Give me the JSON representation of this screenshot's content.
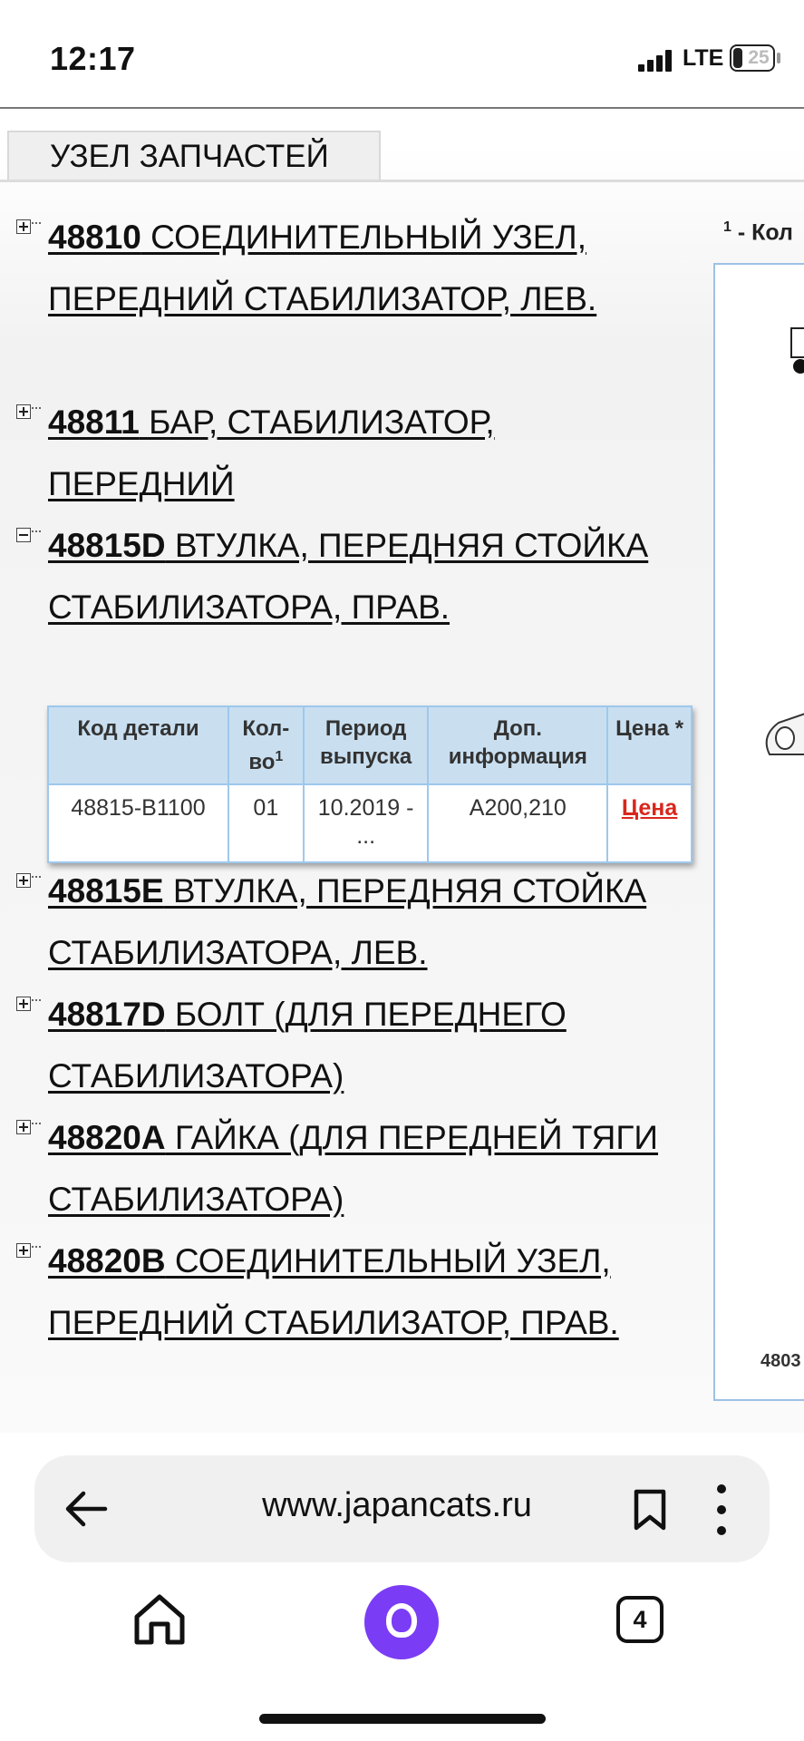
{
  "status": {
    "time": "12:17",
    "network": "LTE",
    "battery": "25"
  },
  "page": {
    "tab_title": "УЗЕЛ ЗАПЧАСТЕЙ",
    "caption_sup": "1",
    "caption_text": " - Кол",
    "diagram_code": "4803"
  },
  "parts": [
    {
      "code": "48810",
      "name": " СОЕДИНИТЕЛЬНЫЙ УЗЕЛ, ПЕРЕДНИЙ СТАБИЛИЗАТОР, ЛЕВ.",
      "expanded": false
    },
    {
      "code": "48811",
      "name": " БАР, СТАБИЛИЗАТОР, ПЕРЕДНИЙ",
      "expanded": false
    },
    {
      "code": "48815D",
      "name": " ВТУЛКА, ПЕРЕДНЯЯ СТОЙКА СТАБИЛИЗАТОРА, ПРАВ.",
      "expanded": true
    },
    {
      "code": "48815E",
      "name": " ВТУЛКА, ПЕРЕДНЯЯ СТОЙКА СТАБИЛИЗАТОРА, ЛЕВ.",
      "expanded": false
    },
    {
      "code": "48817D",
      "name": " БОЛТ (ДЛЯ ПЕРЕДНЕГО СТАБИЛИЗАТОРА)",
      "expanded": false
    },
    {
      "code": "48820A",
      "name": " ГАЙКА (ДЛЯ ПЕРЕДНЕЙ ТЯГИ СТАБИЛИЗАТОРА)",
      "expanded": false
    },
    {
      "code": "48820B",
      "name": " СОЕДИНИТЕЛЬНЫЙ УЗЕЛ, ПЕРЕДНИЙ СТАБИЛИЗАТОР, ПРАВ.",
      "expanded": false
    }
  ],
  "table": {
    "headers": {
      "code": "Код детали",
      "qty": "Кол-во",
      "qty_sup": "1",
      "period": "Период выпуска",
      "info": "Доп. информация",
      "price": "Цена *"
    },
    "row": {
      "code": "48815-B1100",
      "qty": "01",
      "period": "10.2019 - ...",
      "info": "A200,210",
      "price": "Цена"
    }
  },
  "browser": {
    "url": "www.japancats.ru",
    "tab_count": "4"
  }
}
